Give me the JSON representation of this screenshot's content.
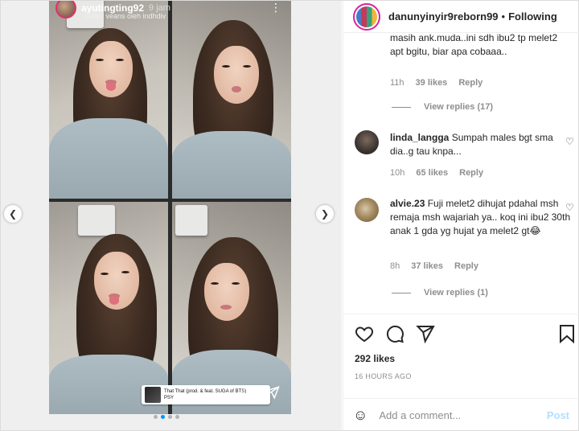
{
  "story": {
    "username": "ayutingting92",
    "time": "9 jam",
    "subtitle": "gileen veans oleh indhdiv",
    "more_icon": "⋮",
    "music_line1": "That That (prod. & feat. SUGA of BTS)",
    "music_line2": "PSY"
  },
  "post": {
    "username": "danunyinyir9reborn99",
    "separator": "•",
    "follow_state": "Following"
  },
  "comments": [
    {
      "text": "masih ank.muda..ini sdh ibu2 tp melet2 apt bgitu, biar apa cobaaa..",
      "time": "11h",
      "likes": "39 likes",
      "reply": "Reply",
      "view_replies": "View replies (17)"
    },
    {
      "username": "linda_langga",
      "text": "Sumpah males bgt sma dia..g tau knpa...",
      "time": "10h",
      "likes": "65 likes",
      "reply": "Reply"
    },
    {
      "username": "alvie.23",
      "text": "Fuji melet2 dihujat pdahal msh remaja msh wajariah ya.. koq ini ibu2 30th anak 1 gda yg hujat ya melet2 gt😂",
      "time": "8h",
      "likes": "37 likes",
      "reply": "Reply",
      "view_replies": "View replies (1)"
    }
  ],
  "actions": {
    "likes": "292 likes",
    "timestamp": "16 HOURS AGO"
  },
  "comment_box": {
    "placeholder": "Add a comment...",
    "post_label": "Post"
  },
  "carousel": {
    "dots": 4,
    "active": 1
  },
  "colors": {
    "accent": "#0095f6",
    "post_disabled": "#b2dffc",
    "meta": "#8e8e8e"
  }
}
